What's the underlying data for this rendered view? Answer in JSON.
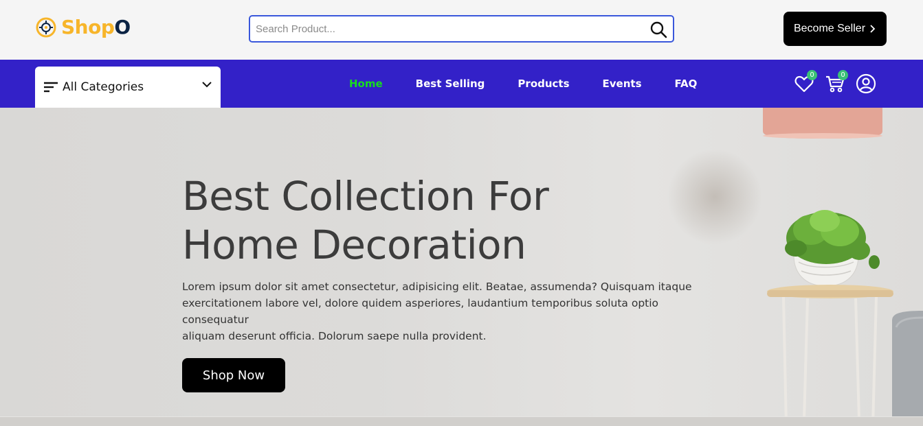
{
  "brand": {
    "name_part1": "Shop",
    "name_part2": "O",
    "colors": {
      "primary": "#f7b52a",
      "secondary": "#0b2344"
    }
  },
  "search": {
    "placeholder": "Search Product...",
    "value": "",
    "icon": "search-icon"
  },
  "header": {
    "become_seller_label": "Become Seller",
    "become_seller_icon": "chevron-right-icon"
  },
  "navbar": {
    "background": "#3321c8",
    "categories_label": "All Categories",
    "links": [
      {
        "label": "Home",
        "active": true
      },
      {
        "label": "Best Selling",
        "active": false
      },
      {
        "label": "Products",
        "active": false
      },
      {
        "label": "Events",
        "active": false
      },
      {
        "label": "FAQ",
        "active": false
      }
    ],
    "wishlist_count": "0",
    "cart_count": "0",
    "active_color": "#17dd1f"
  },
  "hero": {
    "title_line1": "Best Collection For",
    "title_line2": "Home Decoration",
    "description_line1": "Lorem ipsum dolor sit amet consectetur, adipisicing elit. Beatae, assumenda? Quisquam itaque",
    "description_line2": "exercitationem labore vel, dolore quidem asperiores, laudantium temporibus soluta optio",
    "description_line3": "consequatur",
    "description_line4": "aliquam deserunt officia. Dolorum saepe nulla provident.",
    "cta_label": "Shop Now"
  }
}
